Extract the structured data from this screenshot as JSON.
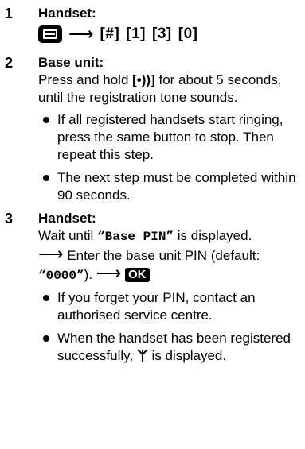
{
  "steps": [
    {
      "number": "1",
      "heading": "Handset:",
      "keys": [
        "[#]",
        "[1]",
        "[3]",
        "[0]"
      ]
    },
    {
      "number": "2",
      "heading": "Base unit:",
      "text_before_key": "Press and hold ",
      "key": "[•))]",
      "text_after_key": " for about 5 seconds, until the registration tone sounds.",
      "bullets": [
        "If all registered handsets start ringing, press the same button to stop. Then repeat this step.",
        "The next step must be completed within 90 seconds."
      ]
    },
    {
      "number": "3",
      "heading": "Handset:",
      "wait_prefix": "Wait until ",
      "base_pin": "“Base PIN”",
      "wait_suffix": " is displayed.",
      "enter_text": " Enter the base unit PIN (default: ",
      "default_pin": "“0000”",
      "enter_suffix": ").",
      "ok_label": "OK",
      "bullets": [
        "If you forget your PIN, contact an authorised service centre."
      ],
      "last_bullet_prefix": "When the handset has been registered successfully, ",
      "last_bullet_suffix": " is displayed."
    }
  ],
  "icons": {
    "menu_key": "menu-key-icon",
    "arrow": "right-arrow-icon",
    "antenna": "antenna-signal-icon"
  }
}
